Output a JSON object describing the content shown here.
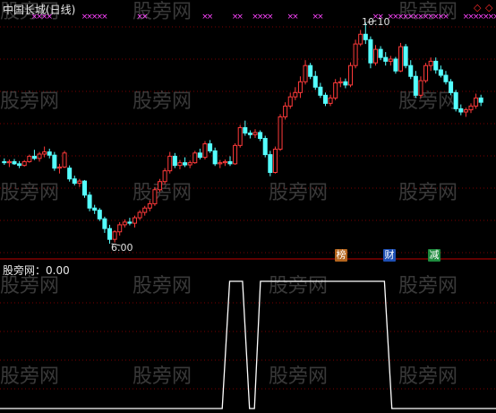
{
  "chart_title": "中国长城(日线)",
  "indicator_label": "股旁网：0.00",
  "high_label": "10.10",
  "low_label": "6.00",
  "badges": [
    {
      "text": "榜",
      "color": "#b5651d"
    },
    {
      "text": "财",
      "color": "#1e4fb4"
    },
    {
      "text": "减",
      "color": "#1e8b3e"
    }
  ],
  "diamonds": [
    "◇",
    "◇"
  ],
  "watermark": "股旁网",
  "colors": {
    "up": "#ff3a3a",
    "down": "#54ffff",
    "signal_mark": "#ff44ff",
    "indicator_line": "#ffffff",
    "grid": "#7a0000",
    "separator": "#c00000"
  },
  "chart_data": {
    "type": "candlestick",
    "price_high": 10.1,
    "price_low": 6.0,
    "indicator_value": 0.0,
    "candles": [
      {
        "o": 7.52,
        "h": 7.58,
        "l": 7.46,
        "c": 7.5
      },
      {
        "o": 7.5,
        "h": 7.56,
        "l": 7.42,
        "c": 7.52
      },
      {
        "o": 7.52,
        "h": 7.57,
        "l": 7.46,
        "c": 7.48
      },
      {
        "o": 7.48,
        "h": 7.53,
        "l": 7.4,
        "c": 7.45
      },
      {
        "o": 7.45,
        "h": 7.55,
        "l": 7.43,
        "c": 7.52
      },
      {
        "o": 7.52,
        "h": 7.65,
        "l": 7.5,
        "c": 7.62
      },
      {
        "o": 7.62,
        "h": 7.74,
        "l": 7.55,
        "c": 7.58
      },
      {
        "o": 7.58,
        "h": 7.7,
        "l": 7.52,
        "c": 7.66
      },
      {
        "o": 7.66,
        "h": 7.8,
        "l": 7.6,
        "c": 7.7
      },
      {
        "o": 7.7,
        "h": 7.76,
        "l": 7.58,
        "c": 7.64
      },
      {
        "o": 7.64,
        "h": 7.7,
        "l": 7.35,
        "c": 7.4
      },
      {
        "o": 7.4,
        "h": 7.48,
        "l": 7.3,
        "c": 7.42
      },
      {
        "o": 7.42,
        "h": 7.72,
        "l": 7.4,
        "c": 7.68
      },
      {
        "o": 7.4,
        "h": 7.45,
        "l": 7.15,
        "c": 7.2
      },
      {
        "o": 7.2,
        "h": 7.26,
        "l": 7.08,
        "c": 7.12
      },
      {
        "o": 7.12,
        "h": 7.2,
        "l": 7.05,
        "c": 7.16
      },
      {
        "o": 7.16,
        "h": 7.18,
        "l": 6.85,
        "c": 6.9
      },
      {
        "o": 6.9,
        "h": 6.96,
        "l": 6.6,
        "c": 6.66
      },
      {
        "o": 6.66,
        "h": 6.72,
        "l": 6.55,
        "c": 6.62
      },
      {
        "o": 6.62,
        "h": 6.66,
        "l": 6.42,
        "c": 6.46
      },
      {
        "o": 6.46,
        "h": 6.5,
        "l": 6.2,
        "c": 6.28
      },
      {
        "o": 6.28,
        "h": 6.35,
        "l": 6.0,
        "c": 6.08
      },
      {
        "o": 6.08,
        "h": 6.25,
        "l": 6.02,
        "c": 6.22
      },
      {
        "o": 6.22,
        "h": 6.4,
        "l": 6.15,
        "c": 6.35
      },
      {
        "o": 6.35,
        "h": 6.45,
        "l": 6.3,
        "c": 6.4
      },
      {
        "o": 6.4,
        "h": 6.48,
        "l": 6.34,
        "c": 6.38
      },
      {
        "o": 6.38,
        "h": 6.52,
        "l": 6.3,
        "c": 6.48
      },
      {
        "o": 6.48,
        "h": 6.62,
        "l": 6.44,
        "c": 6.58
      },
      {
        "o": 6.58,
        "h": 6.7,
        "l": 6.52,
        "c": 6.66
      },
      {
        "o": 6.66,
        "h": 6.8,
        "l": 6.6,
        "c": 6.74
      },
      {
        "o": 6.74,
        "h": 7.05,
        "l": 6.7,
        "c": 7.0
      },
      {
        "o": 7.0,
        "h": 7.2,
        "l": 6.96,
        "c": 7.15
      },
      {
        "o": 7.15,
        "h": 7.4,
        "l": 7.1,
        "c": 7.35
      },
      {
        "o": 7.35,
        "h": 7.7,
        "l": 7.3,
        "c": 7.62
      },
      {
        "o": 7.62,
        "h": 7.68,
        "l": 7.4,
        "c": 7.45
      },
      {
        "o": 7.45,
        "h": 7.55,
        "l": 7.38,
        "c": 7.5
      },
      {
        "o": 7.5,
        "h": 7.6,
        "l": 7.42,
        "c": 7.46
      },
      {
        "o": 7.46,
        "h": 7.54,
        "l": 7.4,
        "c": 7.5
      },
      {
        "o": 7.5,
        "h": 7.72,
        "l": 7.48,
        "c": 7.68
      },
      {
        "o": 7.68,
        "h": 7.76,
        "l": 7.56,
        "c": 7.6
      },
      {
        "o": 7.6,
        "h": 7.9,
        "l": 7.56,
        "c": 7.85
      },
      {
        "o": 7.85,
        "h": 7.92,
        "l": 7.68,
        "c": 7.72
      },
      {
        "o": 7.72,
        "h": 7.78,
        "l": 7.44,
        "c": 7.48
      },
      {
        "o": 7.48,
        "h": 7.55,
        "l": 7.4,
        "c": 7.5
      },
      {
        "o": 7.5,
        "h": 7.56,
        "l": 7.44,
        "c": 7.52
      },
      {
        "o": 7.52,
        "h": 7.62,
        "l": 7.44,
        "c": 7.48
      },
      {
        "o": 7.48,
        "h": 7.86,
        "l": 7.46,
        "c": 7.82
      },
      {
        "o": 7.82,
        "h": 8.2,
        "l": 7.78,
        "c": 8.15
      },
      {
        "o": 8.15,
        "h": 8.28,
        "l": 8.0,
        "c": 8.05
      },
      {
        "o": 8.05,
        "h": 8.1,
        "l": 7.95,
        "c": 8.02
      },
      {
        "o": 8.02,
        "h": 8.12,
        "l": 7.96,
        "c": 8.06
      },
      {
        "o": 8.06,
        "h": 8.1,
        "l": 7.9,
        "c": 7.95
      },
      {
        "o": 7.95,
        "h": 8.0,
        "l": 7.6,
        "c": 7.65
      },
      {
        "o": 7.65,
        "h": 7.72,
        "l": 7.25,
        "c": 7.32
      },
      {
        "o": 7.32,
        "h": 7.8,
        "l": 7.3,
        "c": 7.75
      },
      {
        "o": 7.75,
        "h": 8.4,
        "l": 7.72,
        "c": 8.35
      },
      {
        "o": 8.35,
        "h": 8.62,
        "l": 8.3,
        "c": 8.55
      },
      {
        "o": 8.55,
        "h": 8.8,
        "l": 8.5,
        "c": 8.72
      },
      {
        "o": 8.72,
        "h": 8.9,
        "l": 8.66,
        "c": 8.8
      },
      {
        "o": 8.8,
        "h": 9.1,
        "l": 8.7,
        "c": 9.0
      },
      {
        "o": 9.0,
        "h": 9.4,
        "l": 8.95,
        "c": 9.3
      },
      {
        "o": 9.3,
        "h": 9.35,
        "l": 9.05,
        "c": 9.1
      },
      {
        "o": 9.1,
        "h": 9.2,
        "l": 8.85,
        "c": 8.9
      },
      {
        "o": 8.9,
        "h": 8.98,
        "l": 8.7,
        "c": 8.75
      },
      {
        "o": 8.75,
        "h": 8.8,
        "l": 8.55,
        "c": 8.6
      },
      {
        "o": 8.6,
        "h": 8.76,
        "l": 8.55,
        "c": 8.7
      },
      {
        "o": 8.7,
        "h": 9.05,
        "l": 8.66,
        "c": 8.98
      },
      {
        "o": 8.98,
        "h": 9.08,
        "l": 8.9,
        "c": 9.0
      },
      {
        "o": 9.0,
        "h": 9.06,
        "l": 8.88,
        "c": 8.94
      },
      {
        "o": 8.94,
        "h": 9.36,
        "l": 8.9,
        "c": 9.3
      },
      {
        "o": 9.3,
        "h": 9.78,
        "l": 9.25,
        "c": 9.7
      },
      {
        "o": 9.7,
        "h": 9.96,
        "l": 9.66,
        "c": 9.88
      },
      {
        "o": 9.88,
        "h": 10.1,
        "l": 9.7,
        "c": 9.78
      },
      {
        "o": 9.78,
        "h": 9.84,
        "l": 9.25,
        "c": 9.35
      },
      {
        "o": 9.35,
        "h": 9.68,
        "l": 9.3,
        "c": 9.6
      },
      {
        "o": 9.6,
        "h": 9.66,
        "l": 9.4,
        "c": 9.45
      },
      {
        "o": 9.45,
        "h": 9.55,
        "l": 9.3,
        "c": 9.38
      },
      {
        "o": 9.38,
        "h": 9.48,
        "l": 9.3,
        "c": 9.42
      },
      {
        "o": 9.42,
        "h": 9.46,
        "l": 9.15,
        "c": 9.2
      },
      {
        "o": 9.2,
        "h": 9.72,
        "l": 9.18,
        "c": 9.65
      },
      {
        "o": 9.65,
        "h": 9.7,
        "l": 9.25,
        "c": 9.3
      },
      {
        "o": 9.3,
        "h": 9.4,
        "l": 9.05,
        "c": 9.1
      },
      {
        "o": 9.1,
        "h": 9.2,
        "l": 8.7,
        "c": 8.75
      },
      {
        "o": 8.75,
        "h": 9.1,
        "l": 8.7,
        "c": 9.02
      },
      {
        "o": 9.02,
        "h": 9.35,
        "l": 8.98,
        "c": 9.3
      },
      {
        "o": 9.3,
        "h": 9.45,
        "l": 9.2,
        "c": 9.38
      },
      {
        "o": 9.38,
        "h": 9.45,
        "l": 9.15,
        "c": 9.22
      },
      {
        "o": 9.22,
        "h": 9.3,
        "l": 9.08,
        "c": 9.12
      },
      {
        "o": 9.12,
        "h": 9.2,
        "l": 8.95,
        "c": 9.0
      },
      {
        "o": 9.0,
        "h": 9.05,
        "l": 8.75,
        "c": 8.8
      },
      {
        "o": 8.8,
        "h": 8.85,
        "l": 8.45,
        "c": 8.5
      },
      {
        "o": 8.5,
        "h": 8.58,
        "l": 8.38,
        "c": 8.44
      },
      {
        "o": 8.44,
        "h": 8.52,
        "l": 8.35,
        "c": 8.48
      },
      {
        "o": 8.48,
        "h": 8.6,
        "l": 8.42,
        "c": 8.55
      },
      {
        "o": 8.55,
        "h": 8.78,
        "l": 8.5,
        "c": 8.7
      },
      {
        "o": 8.7,
        "h": 8.76,
        "l": 8.55,
        "c": 8.62
      }
    ],
    "signal_marks": [
      6,
      7,
      8,
      9,
      16,
      17,
      18,
      19,
      20,
      27,
      28,
      40,
      41,
      46,
      47,
      50,
      51,
      52,
      53,
      57,
      58,
      62,
      63,
      74,
      75,
      77,
      78,
      79,
      80,
      81,
      82,
      83,
      84,
      85,
      86,
      87,
      88,
      92,
      93,
      94,
      95,
      96,
      97,
      98,
      103,
      104
    ],
    "indicator_steps": [
      {
        "x": 0,
        "v": 0
      },
      {
        "x": 0.448,
        "v": 0
      },
      {
        "x": 0.463,
        "v": 1
      },
      {
        "x": 0.489,
        "v": 1
      },
      {
        "x": 0.503,
        "v": 0
      },
      {
        "x": 0.513,
        "v": 0
      },
      {
        "x": 0.525,
        "v": 1
      },
      {
        "x": 0.775,
        "v": 1
      },
      {
        "x": 0.79,
        "v": 0
      },
      {
        "x": 1,
        "v": 0
      }
    ]
  }
}
